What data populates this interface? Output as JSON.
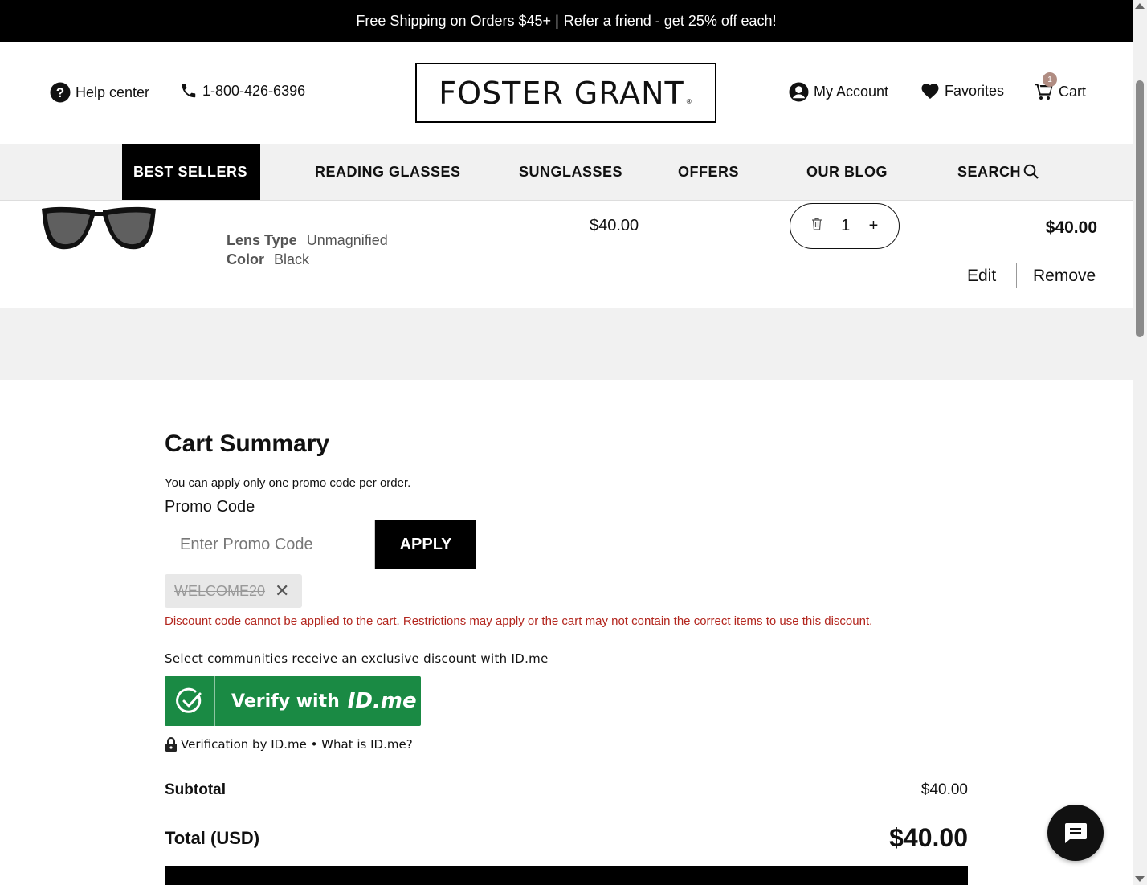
{
  "promo_bar": {
    "text": "Free Shipping on Orders $45+ |",
    "link": "Refer a friend - get 25% off each!"
  },
  "header": {
    "help": "Help center",
    "phone": "1-800-426-6396",
    "logo": "FOSTER GRANT",
    "logo_mark": "®",
    "account": "My Account",
    "favorites": "Favorites",
    "cart": "Cart",
    "cart_count": "1"
  },
  "nav": {
    "items": [
      "BEST SELLERS",
      "READING GLASSES",
      "SUNGLASSES",
      "OFFERS",
      "OUR BLOG",
      "SEARCH"
    ]
  },
  "cart_item": {
    "lens_type_label": "Lens Type",
    "lens_type_value": "Unmagnified",
    "color_label": "Color",
    "color_value": "Black",
    "unit_price": "$40.00",
    "quantity": "1",
    "line_total": "$40.00",
    "edit": "Edit",
    "remove": "Remove"
  },
  "summary": {
    "title": "Cart Summary",
    "note": "You can apply only one promo code per order.",
    "promo_label": "Promo Code",
    "promo_placeholder": "Enter Promo Code",
    "apply": "APPLY",
    "applied_code": "WELCOME20",
    "error": "Discount code cannot be applied to the cart. Restrictions may apply or the cart may not contain the correct items to use this discount.",
    "idme_note": "Select communities receive an exclusive discount with ID.me",
    "idme_button": "Verify with",
    "idme_brand": "ID.me",
    "verification": "Verification by ID.me • What is ID.me?",
    "subtotal_label": "Subtotal",
    "subtotal_value": "$40.00",
    "total_label": "Total (USD)",
    "total_value": "$40.00"
  },
  "colors": {
    "accent": "#000000",
    "idme_green": "#1a8a44",
    "error_red": "#b3261e",
    "cart_badge": "#b08c82"
  }
}
